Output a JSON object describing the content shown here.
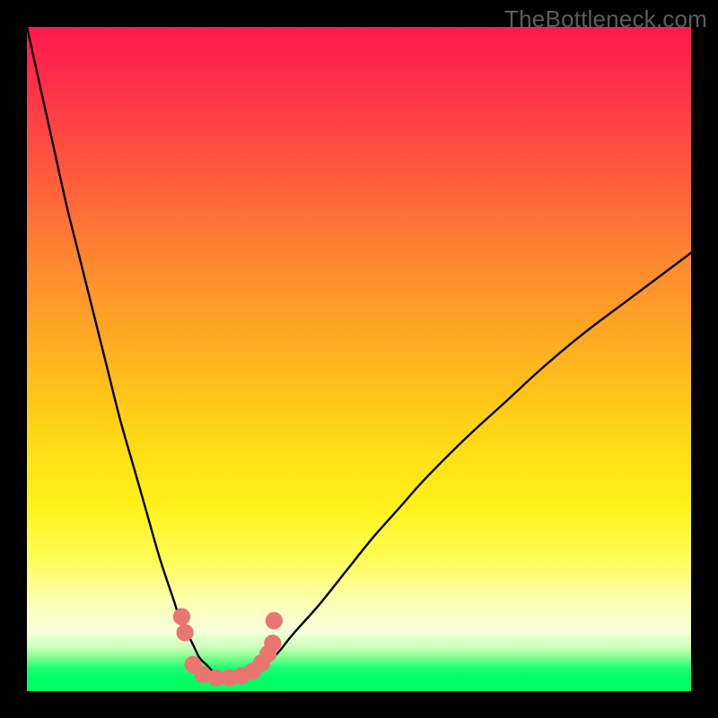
{
  "watermark": "TheBottleneck.com",
  "chart_data": {
    "type": "line",
    "title": "",
    "xlabel": "",
    "ylabel": "",
    "xlim": [
      0,
      100
    ],
    "ylim": [
      0,
      100
    ],
    "series": [
      {
        "name": "curve",
        "x": [
          0,
          2,
          4,
          6,
          8,
          10,
          12,
          14,
          16,
          18,
          20,
          22,
          23,
          24,
          25,
          26,
          27,
          28,
          29,
          30,
          31,
          32,
          33,
          34,
          36,
          38,
          40,
          44,
          48,
          52,
          56,
          60,
          66,
          72,
          78,
          84,
          90,
          96,
          100
        ],
        "y": [
          100,
          91,
          82,
          73,
          65,
          57,
          49,
          41,
          34,
          27,
          20,
          14,
          11,
          9,
          7,
          5,
          4,
          3,
          2.5,
          2.2,
          2,
          2,
          2.2,
          2.6,
          4,
          6,
          8.5,
          13,
          18,
          23,
          27.5,
          32,
          38,
          43.5,
          49,
          54,
          58.5,
          63,
          66
        ]
      }
    ],
    "markers": {
      "color": "#e8766f",
      "radius_plot_units": 1.3,
      "points": [
        {
          "x": 23.3,
          "y": 11.2
        },
        {
          "x": 23.8,
          "y": 8.8
        },
        {
          "x": 25.0,
          "y": 4.0
        },
        {
          "x": 26.5,
          "y": 2.5
        },
        {
          "x": 28.5,
          "y": 2.0
        },
        {
          "x": 30.5,
          "y": 2.0
        },
        {
          "x": 32.3,
          "y": 2.3
        },
        {
          "x": 34.0,
          "y": 3.0
        },
        {
          "x": 35.3,
          "y": 4.2
        },
        {
          "x": 36.3,
          "y": 5.6
        },
        {
          "x": 37.0,
          "y": 7.2
        },
        {
          "x": 37.2,
          "y": 10.6
        }
      ]
    }
  }
}
